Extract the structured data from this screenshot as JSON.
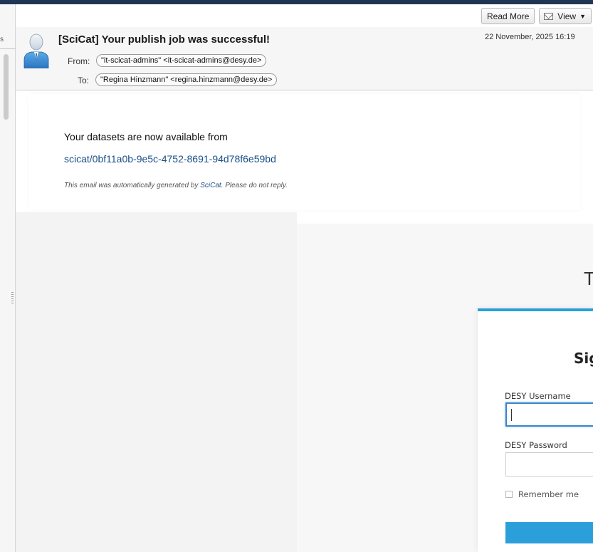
{
  "sidebar": {
    "top_char": "s"
  },
  "toolbar": {
    "read_more_label": "Read More",
    "view_label": "View"
  },
  "email": {
    "subject": "[SciCat] Your publish job was successful!",
    "date": "22 November, 2025 16:19",
    "from_label": "From:",
    "from_value": "\"it-scicat-admins\" <it-scicat-admins@desy.de>",
    "to_label": "To:",
    "to_value": "\"Regina Hinzmann\" <regina.hinzmann@desy.de>",
    "body_intro": "Your datasets are now available from",
    "body_link": "scicat/0bf11a0b-9e5c-4752-8691-94d78f6e59bd",
    "footer_prefix": "This email was automatically generated by ",
    "footer_link": "SciCat",
    "footer_suffix": ". Please do not reply."
  },
  "login": {
    "partial_heading": "T",
    "title": "Sig",
    "username_label": "DESY Username",
    "password_label": "DESY Password",
    "remember_label": "Remember me"
  },
  "colors": {
    "accent": "#2b9fd9",
    "link": "#1a4f88",
    "topbar": "#1f3655"
  },
  "icons": {
    "avatar": "person-icon",
    "view": "envelope-icon",
    "dropdown": "chevron-down-icon"
  }
}
